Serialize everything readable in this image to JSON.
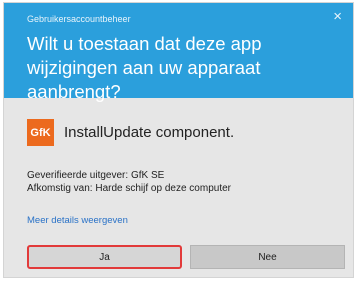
{
  "header": {
    "title": "Gebruikersaccountbeheer",
    "close_glyph": "×",
    "question": "Wilt u toestaan dat deze app wijzigingen aan uw apparaat aanbrengt?"
  },
  "app": {
    "logo_text": "GfK",
    "logo_color": "#ec6a1e",
    "name": "InstallUpdate component."
  },
  "details": {
    "publisher": "Geverifieerde uitgever: GfK SE",
    "origin": "Afkomstig van: Harde schijf op deze computer",
    "more_link": "Meer details weergeven"
  },
  "buttons": {
    "yes": "Ja",
    "no": "Nee"
  },
  "colors": {
    "header_bg": "#2b9fdc",
    "body_bg": "#e6e6e6",
    "link": "#2a72c7",
    "focus_border": "#e23a3a"
  }
}
